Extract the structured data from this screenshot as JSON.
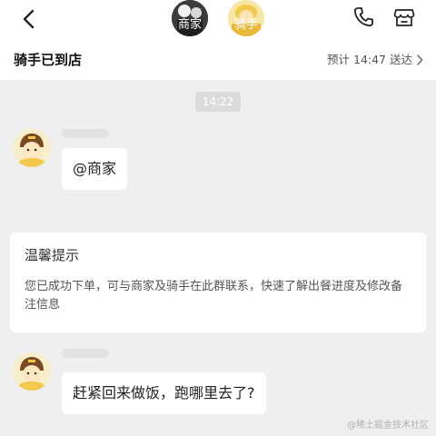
{
  "header": {
    "merchant_label": "商家",
    "rider_label": "骑手",
    "title": "骑手已到店",
    "eta": "预计 14:47 送达",
    "icons": [
      "back-icon",
      "phone-icon",
      "store-icon",
      "chevron-right-icon"
    ]
  },
  "chat": {
    "timestamp": "14:22",
    "messages": [
      {
        "text": "@商家"
      },
      {
        "text": "赶紧回来做饭，跑哪里去了?"
      }
    ]
  },
  "tip": {
    "title": "温馨提示",
    "body": "您已成功下单，可与商家及骑手在此群联系，快速了解出餐进度及修改备注信息"
  },
  "watermark": "@稀土掘金技术社区",
  "colors": {
    "background": "#efefef",
    "bubble": "#ffffff",
    "rider_accent": "#f2c94c"
  }
}
